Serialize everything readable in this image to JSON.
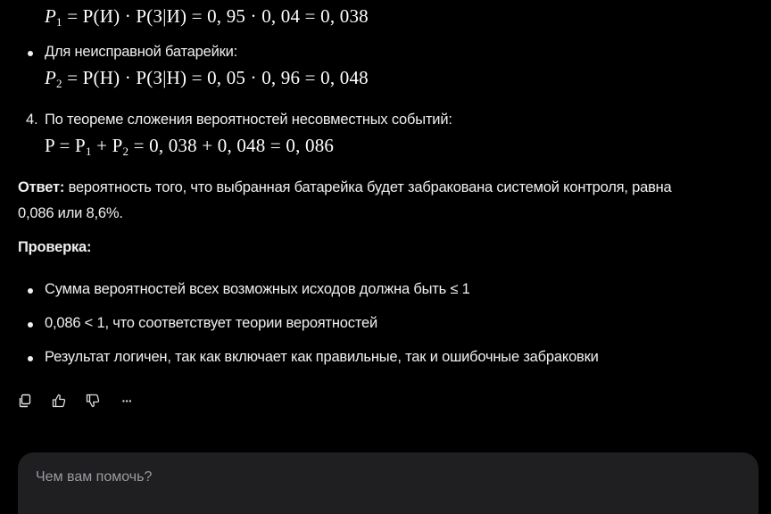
{
  "answer": {
    "formula_p1": {
      "lhs": "P",
      "sub": "1",
      "rhs": "= P(И) · P(З|И) = 0, 95 · 0, 04 = 0, 038"
    },
    "item_faulty_label": "Для неисправной батарейки:",
    "formula_p2": {
      "lhs": "P",
      "sub": "2",
      "rhs": "= P(Н) · P(З|Н) = 0, 05 · 0, 96 = 0, 048"
    },
    "step4_number": "4.",
    "step4_label": "По теореме сложения вероятностей несовместных событий:",
    "formula_total": {
      "lhs": "P = P",
      "sub1": "1",
      "mid": " + P",
      "sub2": "2",
      "rhs": " = 0, 038 + 0, 048 = 0, 086"
    },
    "result_label": "Ответ:",
    "result_text_line1": " вероятность того, что выбранная батарейка будет забракована системой контроля, равна",
    "result_text_line2": "0,086 или 8,6%.",
    "check_title": "Проверка:",
    "check_items": [
      "Сумма вероятностей всех возможных исходов должна быть ≤ 1",
      "0,086 < 1, что соответствует теории вероятностей",
      "Результат логичен, так как включает как правильные, так и ошибочные забраковки"
    ]
  },
  "actions": {
    "copy_icon": "copy-icon",
    "like_icon": "thumbs-up-icon",
    "dislike_icon": "thumbs-down-icon",
    "more_label": "···"
  },
  "composer": {
    "placeholder": "Чем вам помочь?"
  }
}
